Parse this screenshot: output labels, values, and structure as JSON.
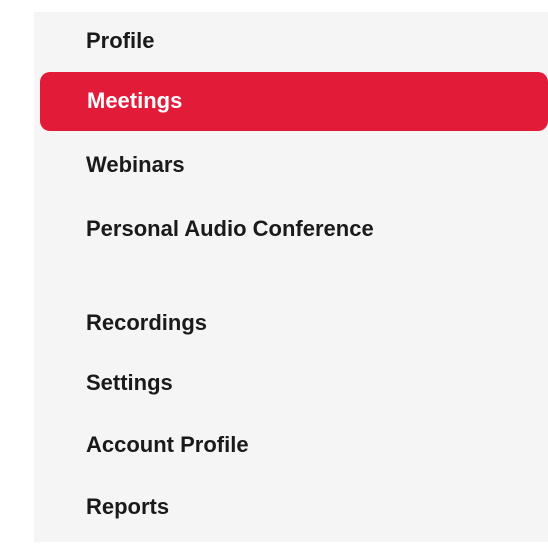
{
  "sidebar": {
    "items": [
      {
        "label": "Profile"
      },
      {
        "label": "Meetings",
        "active": true
      },
      {
        "label": "Webinars"
      },
      {
        "label": "Personal Audio Conference"
      },
      {
        "label": "Recordings"
      },
      {
        "label": "Settings"
      },
      {
        "label": "Account Profile"
      },
      {
        "label": "Reports"
      }
    ],
    "active_color": "#e21b39",
    "background_color": "#f5f5f5"
  }
}
